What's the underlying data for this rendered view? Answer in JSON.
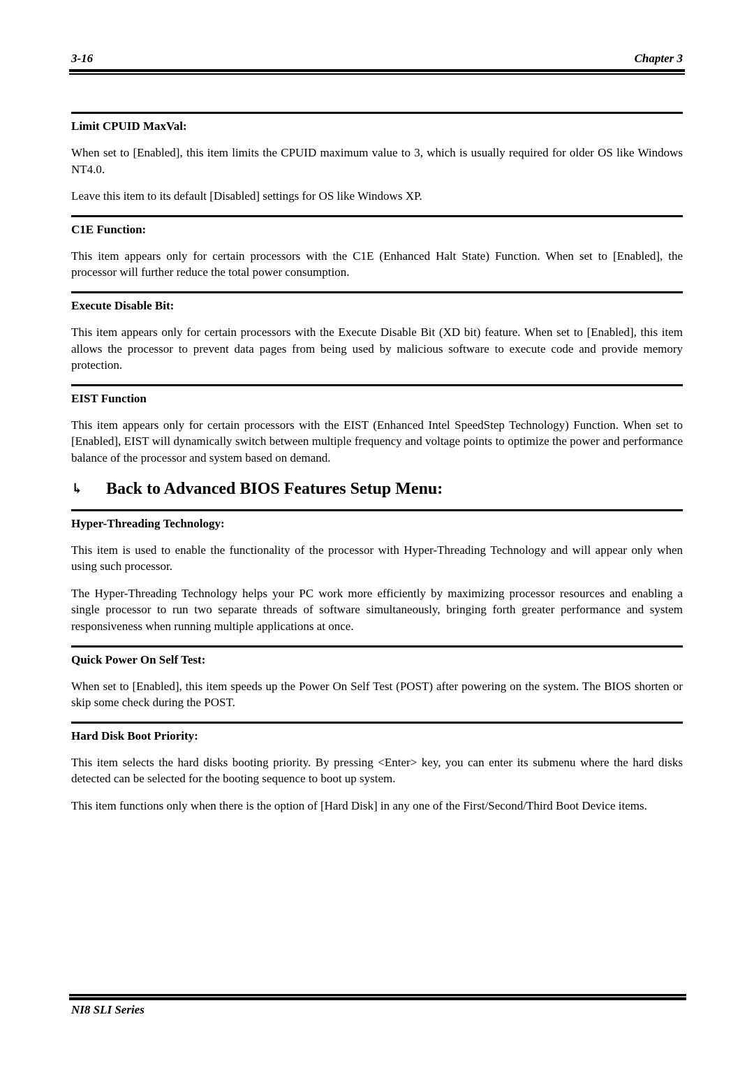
{
  "header": {
    "page_number": "3-16",
    "chapter": "Chapter 3"
  },
  "footer": {
    "series": "NI8 SLI Series"
  },
  "sections_before": [
    {
      "title": "Limit CPUID MaxVal:",
      "paragraphs": [
        "When set to [Enabled], this item limits the CPUID maximum value to 3, which is usually required for older OS like Windows NT4.0.",
        "Leave this item to its default [Disabled] settings for OS like Windows XP."
      ]
    },
    {
      "title": "C1E Function:",
      "paragraphs": [
        "This item appears only for certain processors with the C1E (Enhanced Halt State) Function. When set to [Enabled], the processor will further reduce the total power consumption."
      ]
    },
    {
      "title": "Execute Disable Bit:",
      "paragraphs": [
        "This item appears only for certain processors with the Execute Disable Bit (XD bit) feature. When set to [Enabled], this item allows the processor to prevent data pages from being used by malicious software to execute code and provide memory protection."
      ]
    },
    {
      "title": "EIST Function",
      "paragraphs": [
        "This item appears only for certain processors with the EIST (Enhanced Intel SpeedStep Technology) Function. When set to [Enabled], EIST will dynamically switch between multiple frequency and voltage points to optimize the power and performance balance of the processor and system based on demand."
      ]
    }
  ],
  "back_heading": {
    "icon": "hook-arrow-right-icon",
    "glyph": "↳",
    "text": "Back to Advanced BIOS Features Setup Menu:"
  },
  "sections_after": [
    {
      "title": "Hyper-Threading Technology:",
      "paragraphs": [
        "This item is used to enable the functionality of the processor with Hyper-Threading Technology and will appear only when using such processor.",
        "The Hyper-Threading Technology helps your PC work more efficiently by maximizing processor resources and enabling a single processor to run two separate threads of software simultaneously, bringing forth greater performance and system responsiveness when running multiple applications at once."
      ]
    },
    {
      "title": "Quick Power On Self Test:",
      "paragraphs": [
        "When set to [Enabled], this item speeds up the Power On Self Test (POST) after powering on the system. The BIOS shorten or skip some check during the POST."
      ]
    },
    {
      "title": "Hard Disk Boot Priority:",
      "paragraphs": [
        "This item selects the hard disks booting priority. By pressing <Enter> key, you can enter its submenu where the hard disks detected can be selected for the booting sequence to boot up system.",
        "This item functions only when there is the option of [Hard Disk] in any one of the First/Second/Third Boot Device items."
      ]
    }
  ]
}
